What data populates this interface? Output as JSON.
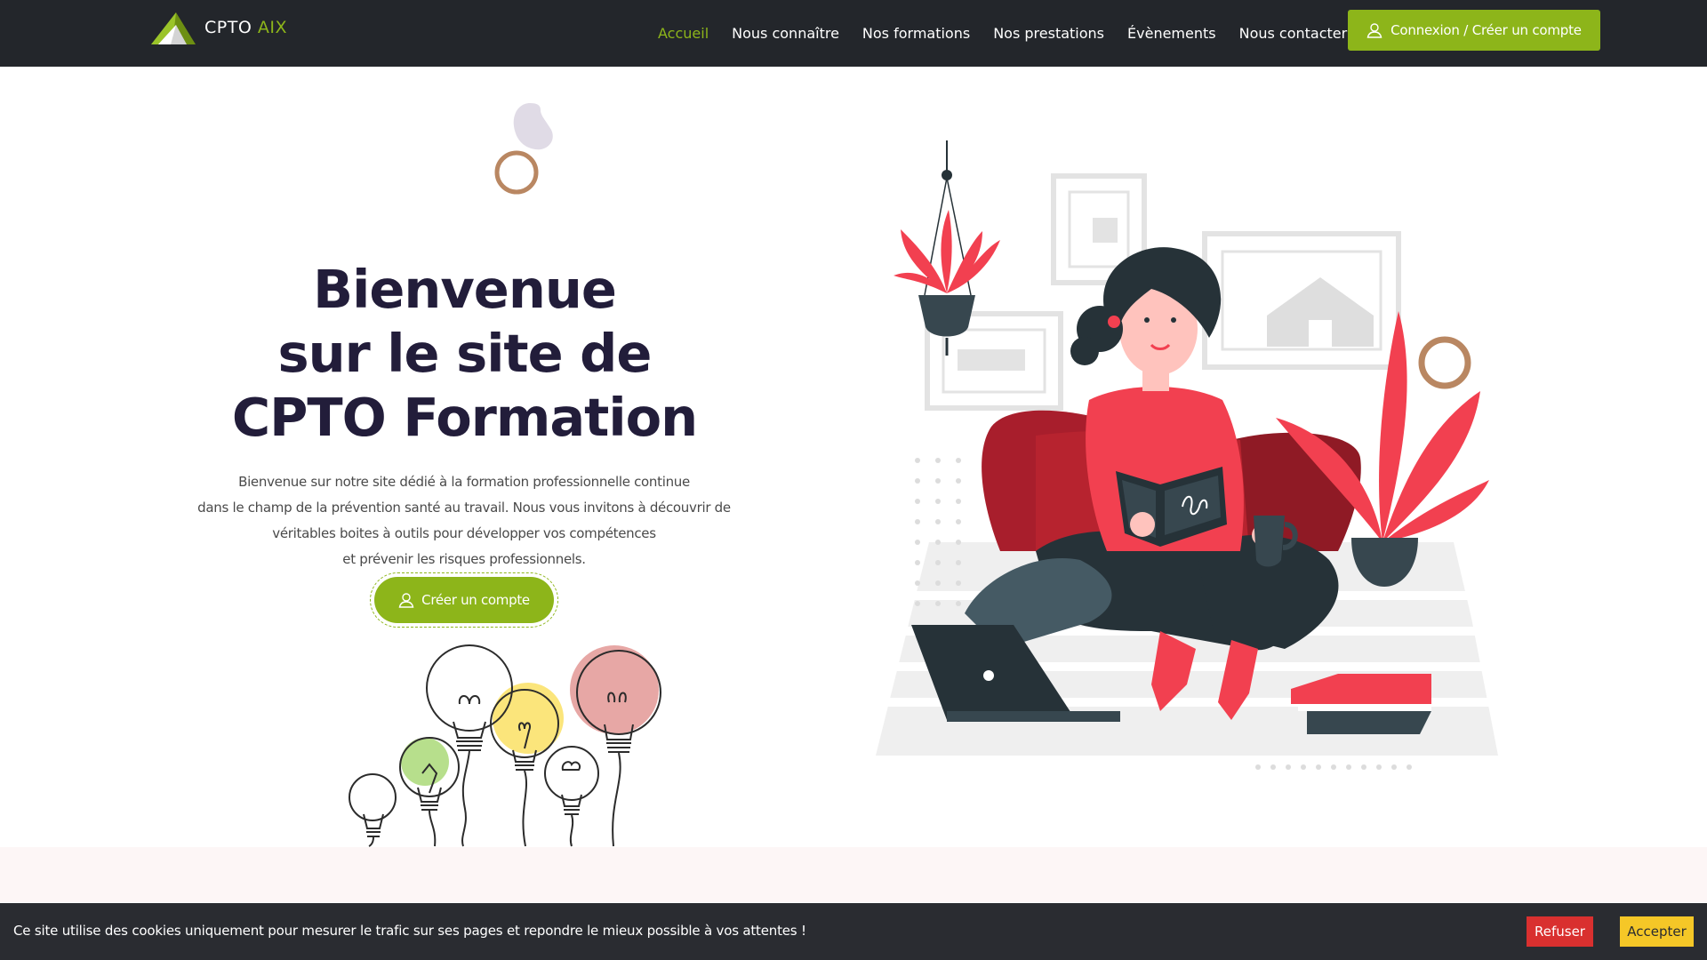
{
  "brand": {
    "name_part1": "CPTO",
    "name_part2": "AIX",
    "accent_color": "#8db51a",
    "header_bg": "#23262b"
  },
  "nav": {
    "items": [
      {
        "label": "Accueil",
        "active": true
      },
      {
        "label": "Nous connaître",
        "active": false
      },
      {
        "label": "Nos formations",
        "active": false
      },
      {
        "label": "Nos prestations",
        "active": false
      },
      {
        "label": "Évènements",
        "active": false
      },
      {
        "label": "Nous contacter",
        "active": false
      }
    ],
    "login_button": "Connexion / Créer un compte",
    "login_icon": "user-icon"
  },
  "hero": {
    "title_lines": [
      "Bienvenue",
      "sur le site de",
      "CPTO Formation"
    ],
    "text_lines": [
      "Bienvenue sur notre site dédié à la formation professionnelle continue",
      "dans le champ de la prévention santé au travail. Nous vous invitons à découvrir de",
      "véritables boites à outils pour développer vos compétences",
      "et prévenir les risques professionnels."
    ],
    "cta_button": "Créer un compte",
    "cta_icon": "user-icon"
  },
  "cookie_bar": {
    "text": "Ce site utilise des cookies uniquement pour mesurer le trafic sur ses pages et repondre le mieux possible à vos attentes !",
    "refuse_label": "Refuser",
    "accept_label": "Accepter",
    "refuse_color": "#d9302f",
    "accept_color": "#f5c727"
  }
}
